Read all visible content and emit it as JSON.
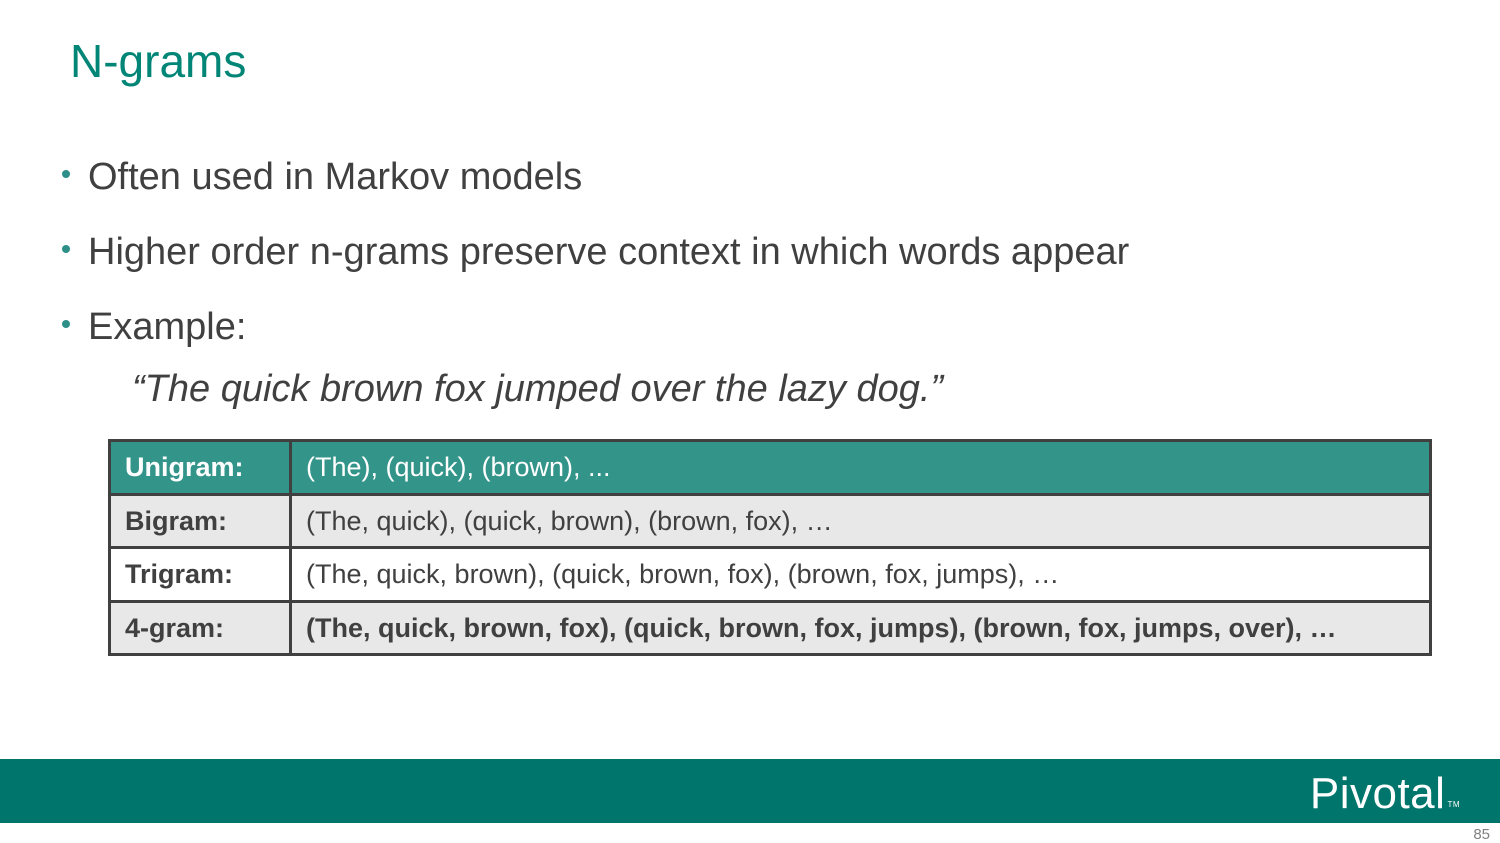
{
  "slide": {
    "title": "N-grams",
    "bullets": [
      "Often used in Markov models",
      "Higher order n-grams preserve context in which words appear",
      "Example:"
    ],
    "quote": "“The quick brown fox jumped over the lazy dog.”",
    "table": {
      "rows": [
        {
          "label": "Unigram:",
          "value": "(The), (quick), (brown), ..."
        },
        {
          "label": "Bigram:",
          "value": "(The, quick), (quick, brown), (brown, fox), …"
        },
        {
          "label": "Trigram:",
          "value": "(The, quick, brown), (quick, brown, fox), (brown, fox, jumps), …"
        },
        {
          "label": "4-gram:",
          "value": "(The, quick, brown, fox), (quick, brown, fox, jumps), (brown, fox, jumps, over), …"
        }
      ]
    },
    "footer": {
      "logo_text": "Pivotal",
      "logo_tm": "TM",
      "page_number": "85"
    }
  },
  "colors": {
    "title": "#008577",
    "footer_bar": "#00756b",
    "table_header": "#33948a",
    "table_shade": "#e8e8e8"
  }
}
